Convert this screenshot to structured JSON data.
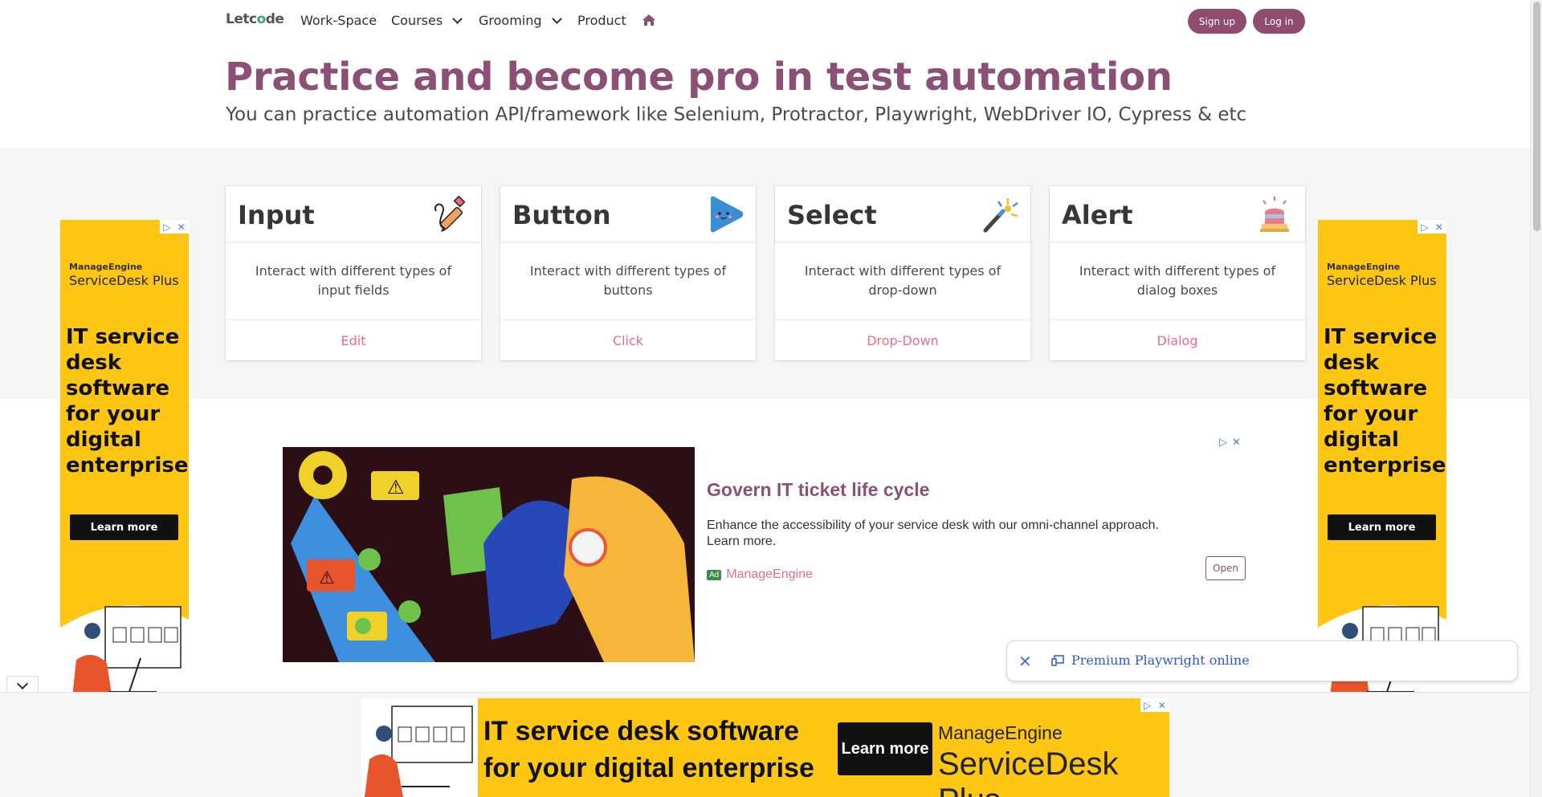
{
  "nav": {
    "logo_prefix": "Let",
    "logo_o": "o",
    "logo_suffix": "de",
    "logo_mid": "c",
    "items": [
      {
        "label": "Work-Space"
      },
      {
        "label": "Courses"
      },
      {
        "label": "Grooming"
      },
      {
        "label": "Product"
      }
    ],
    "signup": "Sign up",
    "login": "Log in"
  },
  "hero": {
    "title": "Practice and become pro in test automation",
    "subtitle": "You can practice automation API/framework like Selenium, Protractor, Playwright, WebDriver IO, Cypress & etc"
  },
  "cards": [
    {
      "title": "Input",
      "desc": "Interact with different types of input fields",
      "link": "Edit",
      "icon": "pencil-icon"
    },
    {
      "title": "Button",
      "desc": "Interact with different types of buttons",
      "link": "Click",
      "icon": "play-button-icon"
    },
    {
      "title": "Select",
      "desc": "Interact with different types of drop-down",
      "link": "Drop-Down",
      "icon": "magic-wand-icon"
    },
    {
      "title": "Alert",
      "desc": "Interact with different types of dialog boxes",
      "link": "Dialog",
      "icon": "siren-icon"
    }
  ],
  "side_ad": {
    "brand_small": "ManageEngine",
    "brand_big": "ServiceDesk Plus",
    "pitch": "IT service desk software for your digital enterprise",
    "learn": "Learn more"
  },
  "mid_ad": {
    "title": "Govern IT ticket life cycle",
    "desc": "Enhance the accessibility of your service desk with our omni-channel approach. Learn more.",
    "badge": "Ad",
    "advertiser": "ManageEngine",
    "open": "Open"
  },
  "promo": {
    "text": "Premium Playwright online"
  },
  "bottom_ad": {
    "pitch_line1": "IT service desk software",
    "pitch_line2": "for your digital enterprise",
    "learn": "Learn more",
    "brand_small": "ManageEngine",
    "brand_big": "ServiceDesk Plus"
  },
  "colors": {
    "brand": "#8c4f75",
    "link": "#e76c8c",
    "ad_yellow": "#fcc613"
  }
}
